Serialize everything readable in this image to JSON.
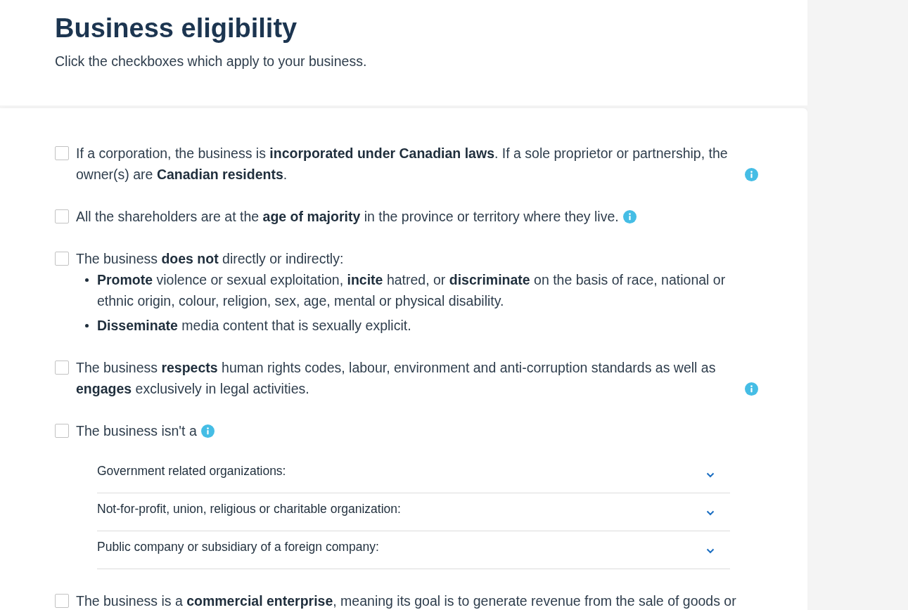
{
  "header": {
    "title": "Business eligibility",
    "subtitle": "Click the checkboxes which apply to your business."
  },
  "criteria": [
    {
      "checked": false,
      "text": "If a corporation, the business is **incorporated under Canadian laws**. If a sole proprietor or partnership, the owner(s) are **Canadian residents**.",
      "info": true
    },
    {
      "checked": false,
      "text": "All the shareholders are at the **age of majority** in the province or territory where they live.",
      "info": true
    },
    {
      "checked": false,
      "text": "The business **does not** directly or indirectly:",
      "bullets": [
        "**Promote** violence or sexual exploitation, **incite** hatred, or **discriminate** on the basis of race, national or ethnic origin, colour, religion, sex, age, mental or physical disability.",
        "**Disseminate** media content that is sexually explicit."
      ]
    },
    {
      "checked": false,
      "text": "The business **respects** human rights codes, labour, environment and anti-corruption standards as well as **engages** exclusively in legal activities.",
      "info": true
    },
    {
      "checked": false,
      "text": "The business isn't a",
      "info": true,
      "sections": [
        {
          "label": "Government related organizations:",
          "expanded": false
        },
        {
          "label": "Not-for-profit, union, religious or charitable organization:",
          "expanded": false
        },
        {
          "label": "Public company or subsidiary of a foreign company:",
          "expanded": false
        }
      ]
    },
    {
      "checked": false,
      "text": "The business is a **commercial enterprise**, meaning its goal is to generate revenue from the sale of goods or"
    }
  ]
}
